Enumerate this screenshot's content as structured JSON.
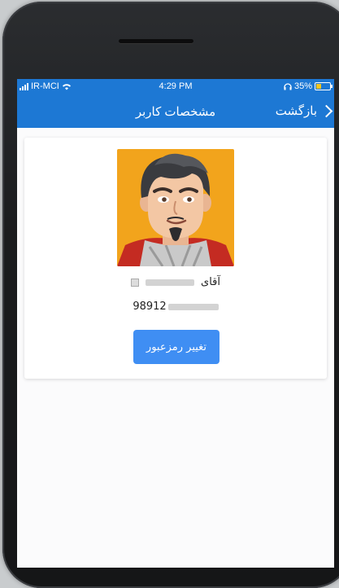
{
  "status_bar": {
    "carrier": "IR-MCI",
    "time": "4:29 PM",
    "battery": "35%",
    "battery_level": 0.35
  },
  "header": {
    "title": "مشخصات کاربر",
    "back_label": "بازگشت"
  },
  "profile": {
    "name_prefix": "آقای",
    "phone_prefix": "98912",
    "change_password_label": "تغییر رمزعبور"
  }
}
